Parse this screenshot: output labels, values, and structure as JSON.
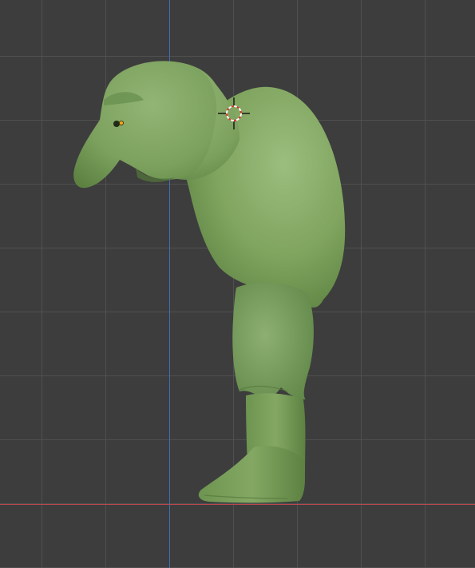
{
  "viewport": {
    "background_color": "#3d3d3d",
    "grid_line_color": "#525252",
    "axis_y_color": "#3f6fb5",
    "axis_x_color": "#b8474f"
  },
  "model": {
    "body_color": "#7fa45e",
    "shadow_color": "#5f8544",
    "highlight_color": "#97b979",
    "origin_color": "#f2a516"
  },
  "cursor_3d": {
    "ring_color_a": "#d9382e",
    "ring_color_b": "#ffffff"
  }
}
